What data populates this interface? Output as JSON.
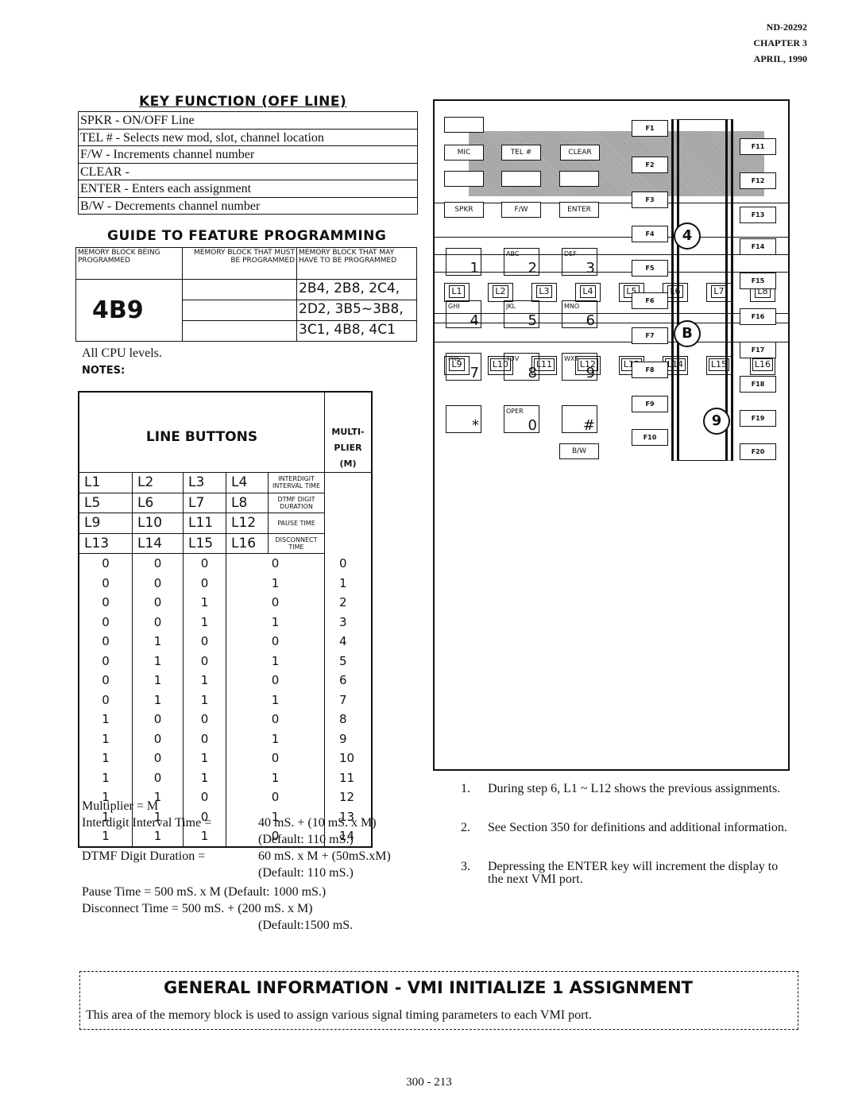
{
  "header": {
    "doc": "ND-20292",
    "chapter": "CHAPTER 3",
    "date": "APRIL, 1990"
  },
  "key_function": {
    "title": "KEY FUNCTION (OFF LINE)",
    "rows": [
      "SPKR - ON/OFF Line",
      "TEL # - Selects new mod, slot, channel location",
      "F/W - Increments channel number",
      "CLEAR -",
      "ENTER - Enters each assignment",
      "B/W - Decrements channel number"
    ]
  },
  "guide": {
    "title": "GUIDE TO FEATURE PROGRAMMING",
    "col1": "MEMORY BLOCK BEING PROGRAMMED",
    "col2": "MEMORY BLOCK THAT MUST BE PROGRAMMED",
    "col3": "MEMORY BLOCK THAT MAY HAVE TO BE PROGRAMMED",
    "block": "4B9",
    "may": [
      "2B4, 2B8, 2C4,",
      "2D2, 3B5~3B8,",
      "3C1, 4B8, 4C1"
    ]
  },
  "cpu_levels": "All CPU levels.",
  "notes_label": "NOTES:",
  "line_buttons": {
    "title": "LINE BUTTONS",
    "multiplier": "MULTI- PLIER (M)",
    "rows": [
      [
        "L1",
        "L2",
        "L3",
        "L4",
        "INTERDIGIT INTERVAL TIME"
      ],
      [
        "L5",
        "L6",
        "L7",
        "L8",
        "DTMF DIGIT DURATION"
      ],
      [
        "L9",
        "L10",
        "L11",
        "L12",
        "PAUSE TIME"
      ],
      [
        "L13",
        "L14",
        "L15",
        "L16",
        "DISCONNECT TIME"
      ]
    ],
    "data": [
      [
        "0",
        "0",
        "0",
        "0",
        "0"
      ],
      [
        "0",
        "0",
        "0",
        "1",
        "1"
      ],
      [
        "0",
        "0",
        "1",
        "0",
        "2"
      ],
      [
        "0",
        "0",
        "1",
        "1",
        "3"
      ],
      [
        "0",
        "1",
        "0",
        "0",
        "4"
      ],
      [
        "0",
        "1",
        "0",
        "1",
        "5"
      ],
      [
        "0",
        "1",
        "1",
        "0",
        "6"
      ],
      [
        "0",
        "1",
        "1",
        "1",
        "7"
      ],
      [
        "1",
        "0",
        "0",
        "0",
        "8"
      ],
      [
        "1",
        "0",
        "0",
        "1",
        "9"
      ],
      [
        "1",
        "0",
        "1",
        "0",
        "10"
      ],
      [
        "1",
        "0",
        "1",
        "1",
        "11"
      ],
      [
        "1",
        "1",
        "0",
        "0",
        "12"
      ],
      [
        "1",
        "1",
        "0",
        "1",
        "13"
      ],
      [
        "1",
        "1",
        "1",
        "0",
        "14"
      ]
    ]
  },
  "formulas": [
    "Multiplier = M",
    "Interdigit Interval Time =",
    "40 mS. + (10 mS. x M)",
    "(Default: 110 mS.)",
    "DTMF Digit Duration =",
    "60 mS. x M + (50mS.xM)",
    "(Default: 110 mS.)",
    "Pause Time = 500 mS. x M (Default: 1000 mS.)",
    "Disconnect Time = 500 mS. + (200 mS. x M)",
    "(Default:1500 mS."
  ],
  "phone": {
    "line_buttons_top": [
      "L1",
      "L2",
      "L3",
      "L4",
      "L5",
      "L6",
      "L7",
      "L8"
    ],
    "line_buttons_bottom": [
      "L9",
      "L10",
      "L11",
      "L12",
      "L13",
      "L14",
      "L15",
      "L16"
    ],
    "func_keys": [
      "MIC",
      "TEL #",
      "CLEAR",
      "SPKR",
      "F/W",
      "ENTER",
      "B/W"
    ],
    "dial": [
      [
        "",
        "1"
      ],
      [
        "ABC",
        "2"
      ],
      [
        "DEF",
        "3"
      ],
      [
        "GHI",
        "4"
      ],
      [
        "JKL",
        "5"
      ],
      [
        "MNO",
        "6"
      ],
      [
        "PRS",
        "7"
      ],
      [
        "TUV",
        "8"
      ],
      [
        "WXY",
        "9"
      ],
      [
        "",
        "*"
      ],
      [
        "OPER",
        "0"
      ],
      [
        "",
        "#"
      ]
    ],
    "f_left": [
      "F1",
      "F2",
      "F3",
      "F4",
      "F5",
      "F6",
      "F7",
      "F8",
      "F9",
      "F10"
    ],
    "f_right": [
      "F11",
      "F12",
      "F13",
      "F14",
      "F15",
      "F16",
      "F17",
      "F18",
      "F19",
      "F20"
    ],
    "circles": [
      "4",
      "B",
      "9"
    ]
  },
  "notes": [
    [
      "1.",
      "During step 6, L1 ~ L12 shows the previous assignments."
    ],
    [
      "2.",
      "See Section 350 for definitions and additional information."
    ],
    [
      "3.",
      "Depressing the ENTER key will increment the display to the next VMI port."
    ]
  ],
  "general": {
    "title": "GENERAL INFORMATION - VMI INITIALIZE 1 ASSIGNMENT",
    "text": "This area of the memory block is used to assign various signal timing parameters to each VMI port."
  },
  "page_number": "300 - 213"
}
